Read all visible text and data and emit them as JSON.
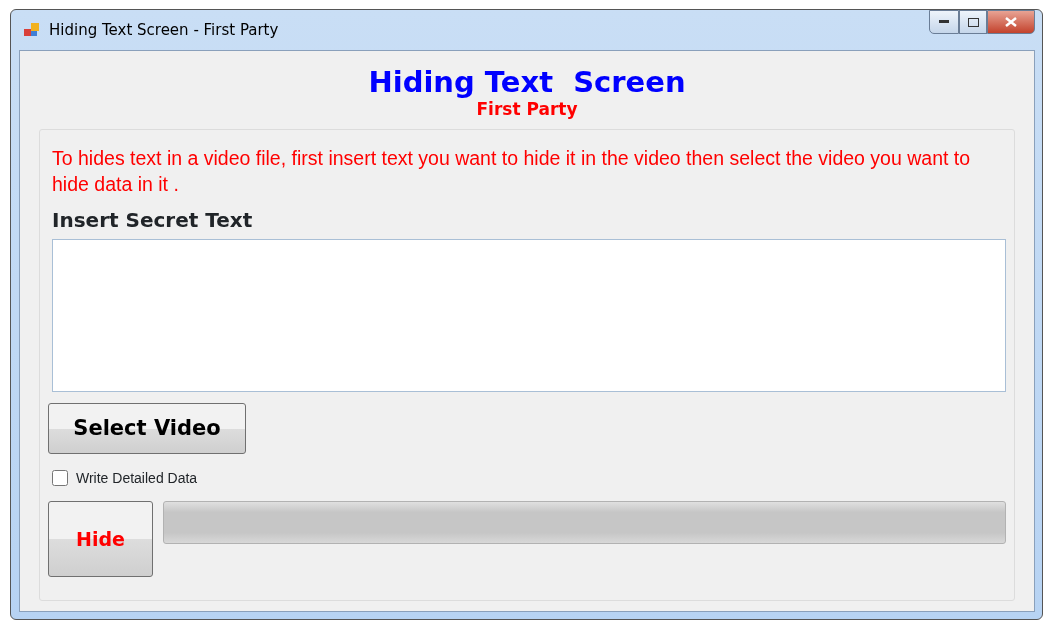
{
  "window": {
    "title": "Hiding Text Screen - First Party"
  },
  "heading": "Hiding Text  Screen",
  "subheading": "First Party",
  "instructions": "To hides text in a video file, first insert text you want to hide it in the video then select the video you want to hide data in it .",
  "secret_text": {
    "label": "Insert Secret Text"
  },
  "select_button": "Select Video",
  "detailed_checkbox": {
    "label": "Write Detailed Data",
    "checked": false
  },
  "hide_button": "Hide",
  "progress": {
    "level": 0
  }
}
